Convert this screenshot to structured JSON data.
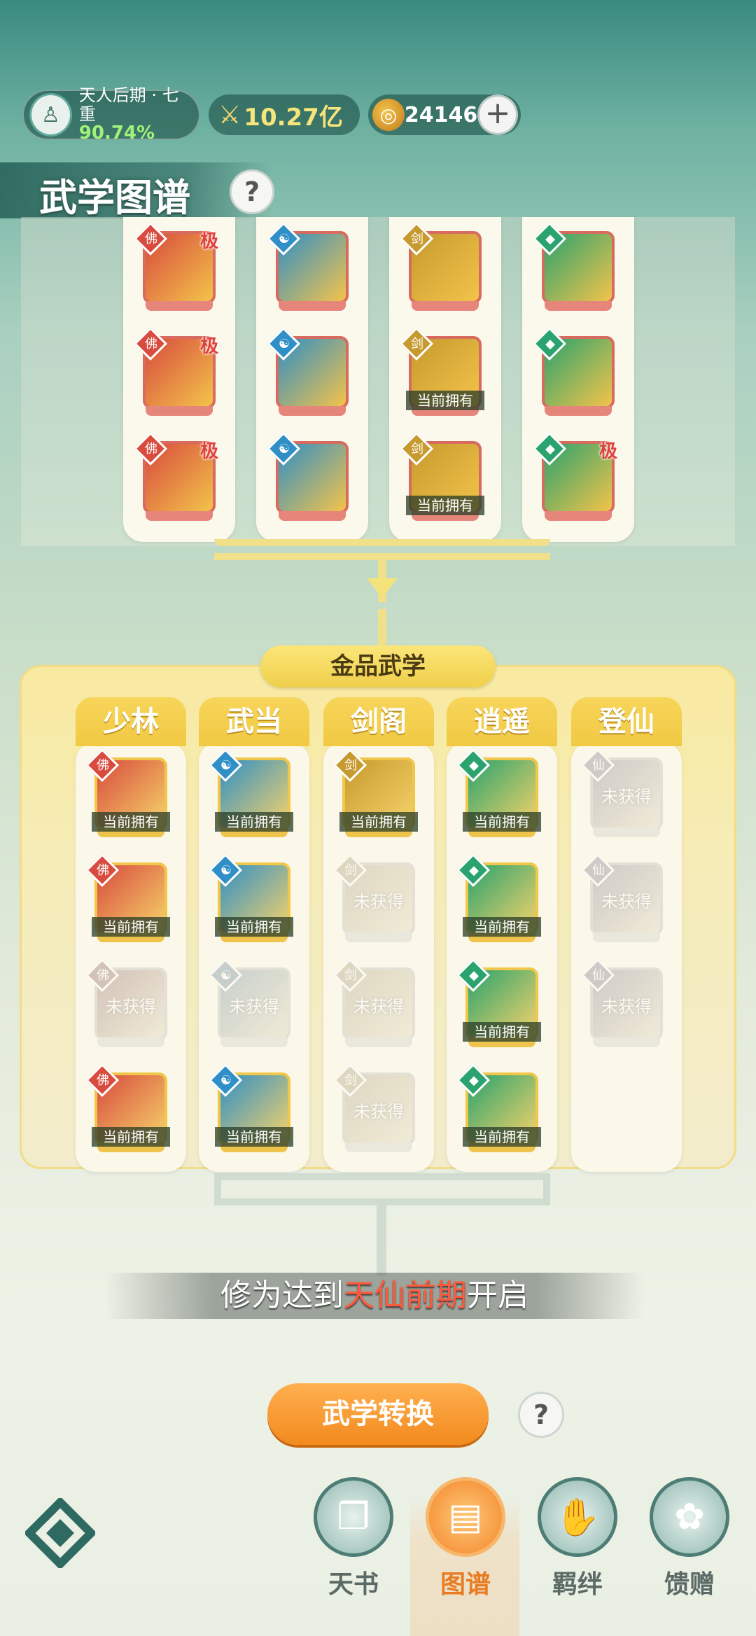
{
  "header": {
    "rank_title": "天人后期 · 七重",
    "rank_progress": "90.74%",
    "power_value": "10.27亿",
    "currency_value": "24146",
    "add_symbol": "+"
  },
  "page": {
    "title": "武学图谱",
    "help": "?"
  },
  "upper_columns": [
    {
      "badge": "red",
      "skills": [
        {
          "owned": false,
          "ji": "极"
        },
        {
          "owned": false,
          "ji": "极"
        },
        {
          "owned": false,
          "ji": "极"
        }
      ]
    },
    {
      "badge": "blue",
      "skills": [
        {
          "owned": false,
          "ji": ""
        },
        {
          "owned": false,
          "ji": ""
        },
        {
          "owned": false,
          "ji": ""
        }
      ]
    },
    {
      "badge": "gold",
      "skills": [
        {
          "owned": false,
          "ji": ""
        },
        {
          "owned": true,
          "ji": ""
        },
        {
          "owned": true,
          "ji": ""
        }
      ]
    },
    {
      "badge": "green",
      "skills": [
        {
          "owned": false,
          "ji": ""
        },
        {
          "owned": false,
          "ji": ""
        },
        {
          "owned": false,
          "ji": "极"
        }
      ]
    }
  ],
  "labels": {
    "owned": "当前拥有",
    "not_obtained": "未获得",
    "ji": "极"
  },
  "gold_section": {
    "title": "金品武学",
    "schools": [
      {
        "name": "少林",
        "badge": "red",
        "skills": [
          "owned",
          "owned",
          "locked",
          "owned"
        ]
      },
      {
        "name": "武当",
        "badge": "blue",
        "skills": [
          "owned",
          "owned",
          "locked",
          "owned"
        ]
      },
      {
        "name": "剑阁",
        "badge": "gold",
        "skills": [
          "owned",
          "locked",
          "locked",
          "locked"
        ]
      },
      {
        "name": "逍遥",
        "badge": "green",
        "skills": [
          "owned",
          "owned",
          "owned",
          "owned"
        ]
      },
      {
        "name": "登仙",
        "badge": "purple",
        "skills": [
          "locked",
          "locked",
          "locked"
        ]
      }
    ]
  },
  "hint": {
    "prefix": "修为达到",
    "highlight": "天仙前期",
    "suffix": "开启"
  },
  "convert_button": "武学转换",
  "convert_help": "?",
  "nav": {
    "items": [
      {
        "label": "天书",
        "icon": "book-icon"
      },
      {
        "label": "图谱",
        "icon": "map-scroll-icon"
      },
      {
        "label": "羁绊",
        "icon": "handshake-icon"
      },
      {
        "label": "馈赠",
        "icon": "gift-icon"
      }
    ],
    "active_index": 1
  },
  "colors": {
    "red": "#d84b3e",
    "blue": "#2f8fc6",
    "gold": "#c69a2e",
    "green": "#2aa36e",
    "purple": "#8c6fb0",
    "accent_orange": "#f28a1e",
    "highlight_red": "#ff5a3c"
  }
}
